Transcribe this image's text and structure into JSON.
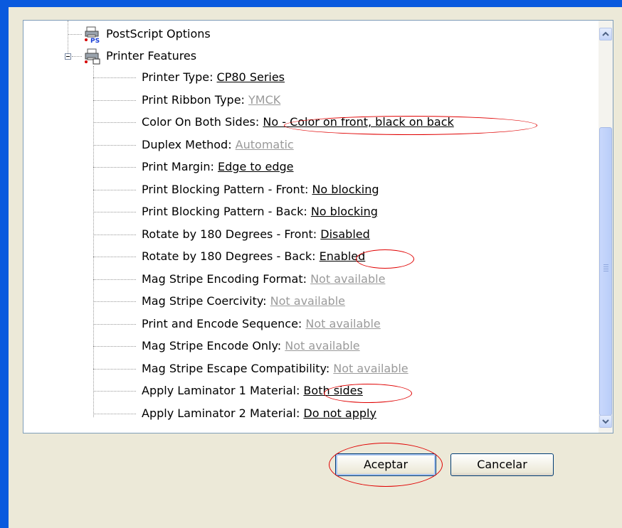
{
  "tree": {
    "postscript_options": "PostScript Options",
    "printer_features": "Printer Features",
    "features": [
      {
        "label": "Printer Type: ",
        "value": "CP80 Series",
        "enabled": true
      },
      {
        "label": "Print Ribbon Type: ",
        "value": "YMCK",
        "enabled": false
      },
      {
        "label": "Color On Both Sides: ",
        "value": "No - Color on front, black on back",
        "enabled": true
      },
      {
        "label": "Duplex Method: ",
        "value": "Automatic",
        "enabled": false
      },
      {
        "label": "Print Margin: ",
        "value": "Edge to edge",
        "enabled": true
      },
      {
        "label": "Print Blocking Pattern - Front: ",
        "value": "No blocking",
        "enabled": true
      },
      {
        "label": "Print Blocking Pattern - Back: ",
        "value": "No blocking",
        "enabled": true
      },
      {
        "label": "Rotate by 180 Degrees - Front: ",
        "value": "Disabled",
        "enabled": true
      },
      {
        "label": "Rotate by 180 Degrees - Back: ",
        "value": "Enabled",
        "enabled": true
      },
      {
        "label": "Mag Stripe Encoding Format: ",
        "value": "Not available",
        "enabled": false
      },
      {
        "label": "Mag Stripe Coercivity: ",
        "value": "Not available",
        "enabled": false
      },
      {
        "label": "Print and Encode Sequence: ",
        "value": "Not available",
        "enabled": false
      },
      {
        "label": "Mag Stripe Encode Only: ",
        "value": "Not available",
        "enabled": false
      },
      {
        "label": "Mag Stripe Escape Compatibility: ",
        "value": "Not available",
        "enabled": false
      },
      {
        "label": "Apply Laminator 1 Material: ",
        "value": "Both sides",
        "enabled": true
      },
      {
        "label": "Apply Laminator 2 Material: ",
        "value": "Do not apply",
        "enabled": true
      }
    ]
  },
  "buttons": {
    "ok": "Aceptar",
    "cancel": "Cancelar"
  },
  "icons": {
    "postscript": "printer-postscript-icon",
    "printer": "printer-icon",
    "collapse": "collapse-minus-icon",
    "scroll_up": "scroll-up-arrow-icon",
    "scroll_down": "scroll-down-arrow-icon"
  },
  "colors": {
    "title_bar": "#0a5ade",
    "dialog_bg": "#ece9d8",
    "disabled_text": "#9a9a9a",
    "annotation": "#e00000"
  }
}
